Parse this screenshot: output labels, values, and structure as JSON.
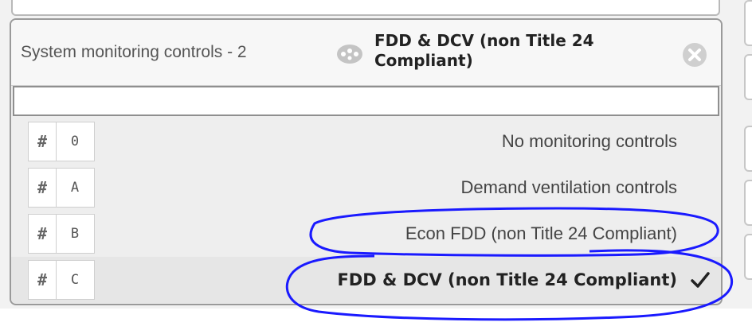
{
  "field": {
    "label": "System monitoring controls - 2",
    "selected_value": "FDD & DCV (non Title 24 Compliant)",
    "search_value": ""
  },
  "options": [
    {
      "code": "0",
      "label": "No monitoring controls",
      "selected": false
    },
    {
      "code": "A",
      "label": "Demand ventilation controls",
      "selected": false
    },
    {
      "code": "B",
      "label": "Econ FDD (non Title 24 Compliant)",
      "selected": false
    },
    {
      "code": "C",
      "label": "FDD & DCV (non Title 24 Compliant)",
      "selected": true
    }
  ],
  "badge_symbol": "#",
  "icons": {
    "help": "help-bubble-icon",
    "clear": "clear-circle-x-icon",
    "check": "checkmark-icon"
  },
  "colors": {
    "annotation": "#1a1aff",
    "selected_row_bg": "#e6e6e6",
    "panel_border": "#9a9a9a"
  }
}
